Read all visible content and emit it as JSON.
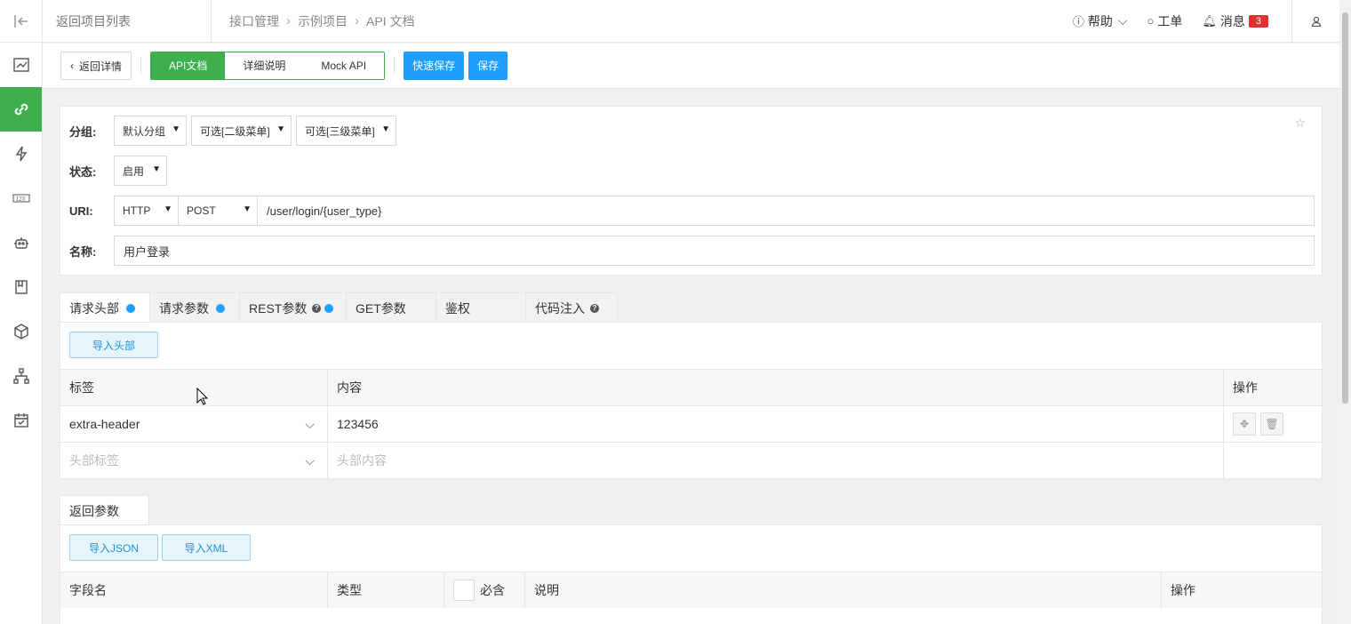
{
  "topbar": {
    "back_to_list": "返回项目列表",
    "breadcrumb": [
      "接口管理",
      "示例项目",
      "API 文档"
    ],
    "help": "帮助",
    "ticket": "工单",
    "messages": "消息",
    "messages_count": "3"
  },
  "toolbar": {
    "back_detail": "返回详情",
    "tabs": [
      "API文档",
      "详细说明",
      "Mock API"
    ],
    "quick_save": "快速保存",
    "save": "保存"
  },
  "form": {
    "group_label": "分组:",
    "group_default": "默认分组",
    "group_level2": "可选[二级菜单]",
    "group_level3": "可选[三级菜单]",
    "status_label": "状态:",
    "status_value": "启用",
    "uri_label": "URI:",
    "protocol": "HTTP",
    "method": "POST",
    "uri_value": "/user/login/{user_type}",
    "name_label": "名称:",
    "name_value": "用户登录"
  },
  "request_tabs": [
    "请求头部",
    "请求参数",
    "REST参数",
    "GET参数",
    "鉴权",
    "代码注入"
  ],
  "headers_panel": {
    "import_button": "导入头部",
    "columns": [
      "标签",
      "内容",
      "操作"
    ],
    "rows": [
      {
        "label": "extra-header",
        "content": "123456"
      }
    ],
    "placeholder_label": "头部标签",
    "placeholder_content": "头部内容"
  },
  "response": {
    "tab": "返回参数",
    "import_json": "导入JSON",
    "import_xml": "导入XML",
    "columns": [
      "字段名",
      "类型",
      "必含",
      "说明",
      "操作"
    ]
  },
  "colors": {
    "accent_green": "#3fae4e",
    "accent_blue": "#1e9fff",
    "badge_red": "#e0332e"
  }
}
